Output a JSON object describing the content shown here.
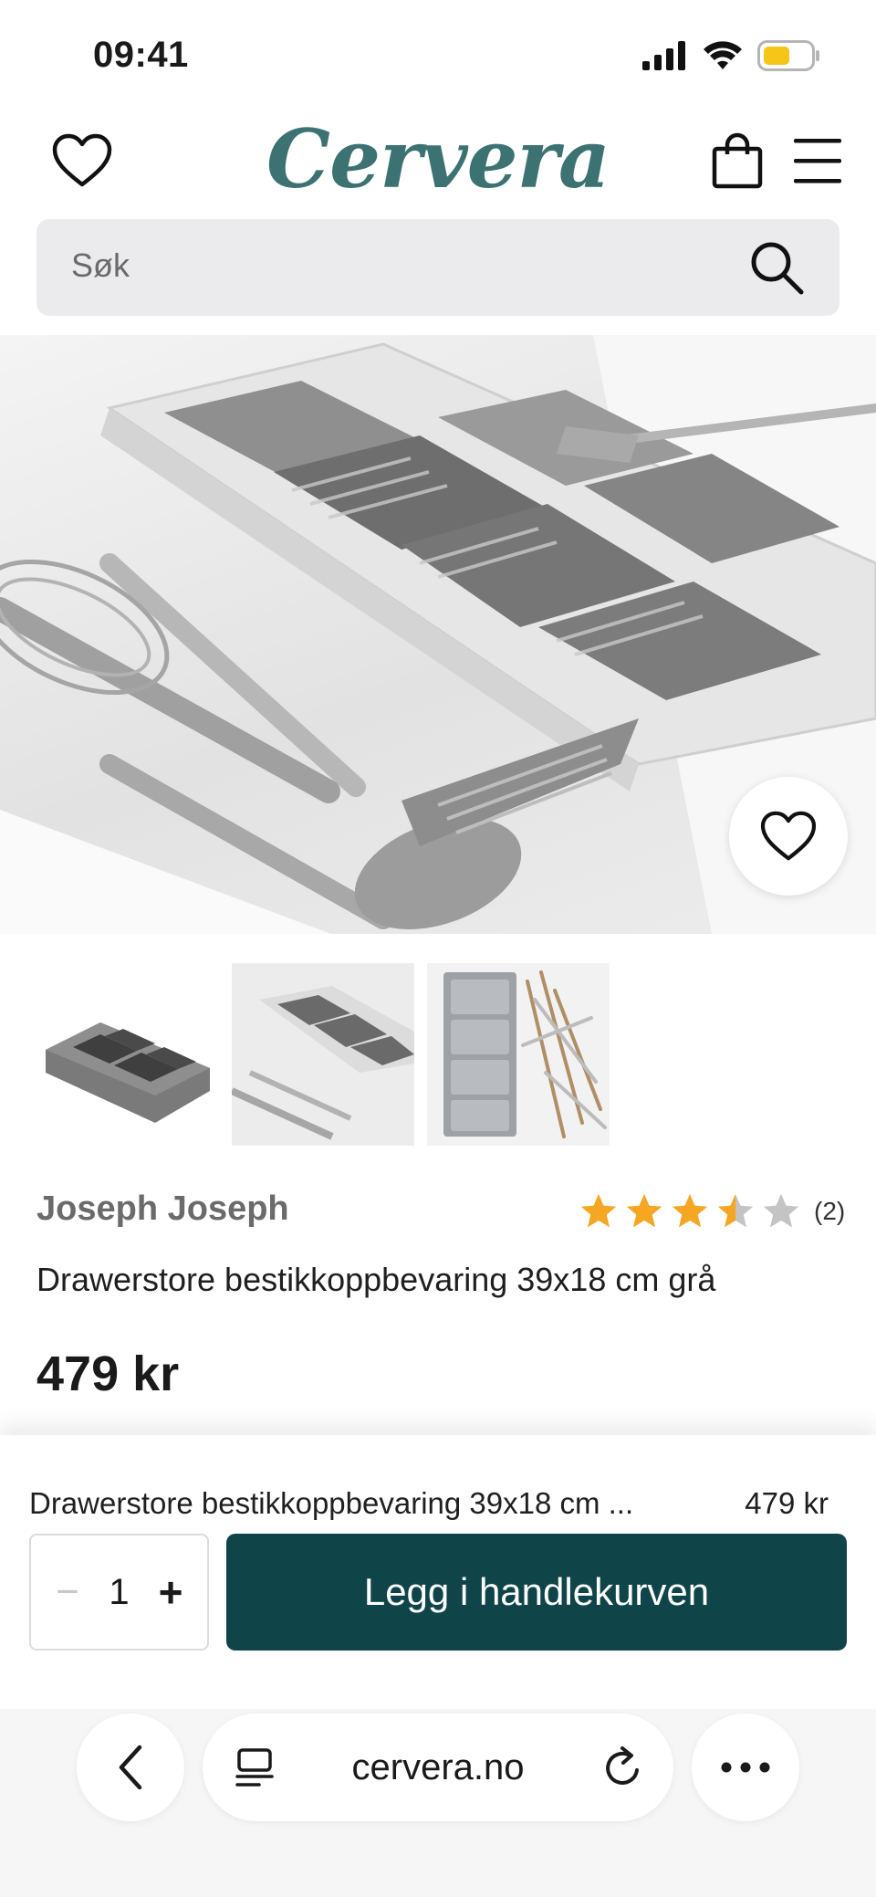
{
  "status_bar": {
    "time": "09:41"
  },
  "header": {
    "logo": "Cervera"
  },
  "search": {
    "placeholder": "Søk"
  },
  "product": {
    "brand": "Joseph Joseph",
    "rating": 3.5,
    "rating_max": 5,
    "review_count": "(2)",
    "name": "Drawerstore bestikkoppbevaring 39x18 cm grå",
    "price": "479 kr"
  },
  "buy_bar": {
    "name": "Drawerstore bestikkoppbevaring 39x18 cm ...",
    "price": "479 kr",
    "qty_minus": "−",
    "quantity": "1",
    "qty_plus": "+",
    "add_to_cart": "Legg i handlekurven"
  },
  "browser": {
    "url": "cervera.no"
  },
  "colors": {
    "brand_teal": "#3d7272",
    "cart_button": "#0f4448",
    "star": "#f5a623",
    "star_empty": "#c4c4c4"
  },
  "icons": [
    "heart-icon",
    "bag-icon",
    "menu-icon",
    "search-icon",
    "star-icon",
    "back-icon",
    "tabs-icon",
    "reload-icon",
    "more-icon"
  ]
}
